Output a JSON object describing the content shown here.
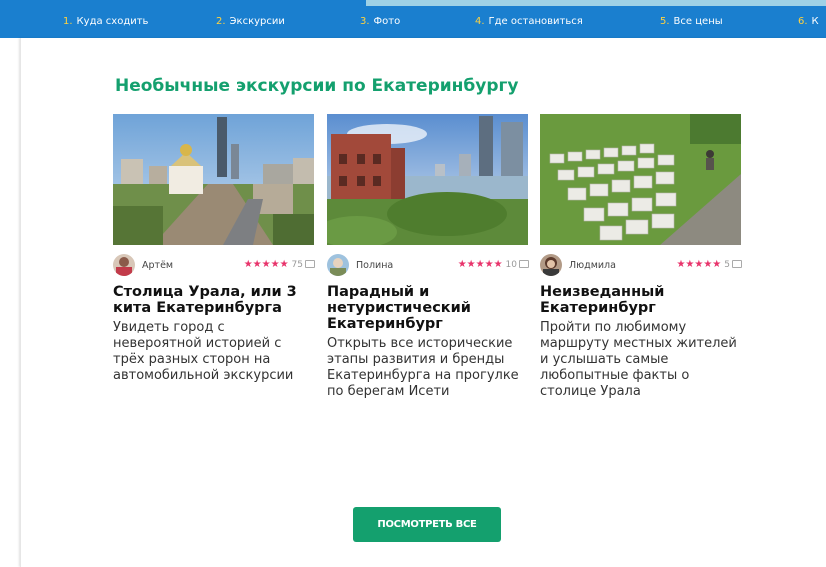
{
  "nav": {
    "items": [
      {
        "num": "1.",
        "label": "Куда сходить"
      },
      {
        "num": "2.",
        "label": "Экскурсии"
      },
      {
        "num": "3.",
        "label": "Фото"
      },
      {
        "num": "4.",
        "label": "Где остановиться"
      },
      {
        "num": "5.",
        "label": "Все цены"
      },
      {
        "num": "6.",
        "label": "К"
      }
    ]
  },
  "section": {
    "title": "Необычные экскурсии по Екатеринбургу"
  },
  "tours": [
    {
      "author": "Артём",
      "stars": "★★★★★",
      "reviews": "75",
      "title": "Столица Урала, или 3 кита Екатеринбурга",
      "description": "Увидеть город с невероятной историей с трёх разных сторон на автомобильной экскурсии"
    },
    {
      "author": "Полина",
      "stars": "★★★★★",
      "reviews": "10",
      "title": "Парадный и нетуристический Екатеринбург",
      "description": "Открыть все исторические этапы развития и бренды Екатеринбурга на прогулке по берегам Исети"
    },
    {
      "author": "Людмила",
      "stars": "★★★★★",
      "reviews": "5",
      "title": "Неизведанный Екатеринбург",
      "description": "Пройти по любимому маршруту местных жителей и услышать самые любопытные факты о столице Урала"
    }
  ],
  "actions": {
    "see_all": "ПОСМОТРЕТЬ ВСЕ"
  },
  "colors": {
    "nav_bg": "#1a7fcf",
    "nav_number": "#ffd23f",
    "accent_green": "#14a06e",
    "stars": "#e8336b"
  }
}
